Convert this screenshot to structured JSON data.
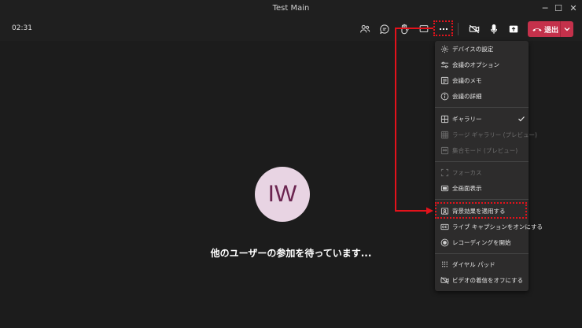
{
  "window": {
    "title": "Test Main"
  },
  "toolbar": {
    "timer": "02:31",
    "leave_label": "退出",
    "icons": [
      "people-icon",
      "chat-icon",
      "raise-hand-icon",
      "share-screen-icon",
      "more-options-icon",
      "video-off-icon",
      "microphone-icon",
      "share-tray-icon"
    ]
  },
  "stage": {
    "avatar_initials": "IW",
    "waiting_text": "他のユーザーの参加を待っています..."
  },
  "menu": {
    "group1": [
      {
        "label": "デバイスの設定",
        "icon": "gear-icon"
      },
      {
        "label": "会議のオプション",
        "icon": "options-icon"
      },
      {
        "label": "会議のメモ",
        "icon": "notes-icon"
      },
      {
        "label": "会議の詳細",
        "icon": "info-icon"
      }
    ],
    "group2": [
      {
        "label": "ギャラリー",
        "icon": "gallery-icon",
        "checked": true
      },
      {
        "label": "ラージ ギャラリー (プレビュー)",
        "icon": "large-gallery-icon",
        "disabled": true
      },
      {
        "label": "集合モード (プレビュー)",
        "icon": "together-mode-icon",
        "disabled": true
      }
    ],
    "group3": [
      {
        "label": "フォーカス",
        "icon": "focus-icon",
        "disabled": true
      },
      {
        "label": "全画面表示",
        "icon": "fullscreen-icon"
      }
    ],
    "group4": [
      {
        "label": "背景効果を適用する",
        "icon": "background-effects-icon",
        "highlighted": true
      },
      {
        "label": "ライブ キャプションをオンにする",
        "icon": "captions-icon"
      },
      {
        "label": "レコーディングを開始",
        "icon": "record-icon"
      }
    ],
    "group5": [
      {
        "label": "ダイヤル パッド",
        "icon": "dialpad-icon"
      },
      {
        "label": "ビデオの着信をオフにする",
        "icon": "video-incoming-off-icon"
      }
    ]
  },
  "colors": {
    "accent_leave": "#c4314b",
    "annotation": "#e3121b",
    "avatar_bg": "#e8d4e3",
    "avatar_text": "#6b2550"
  }
}
